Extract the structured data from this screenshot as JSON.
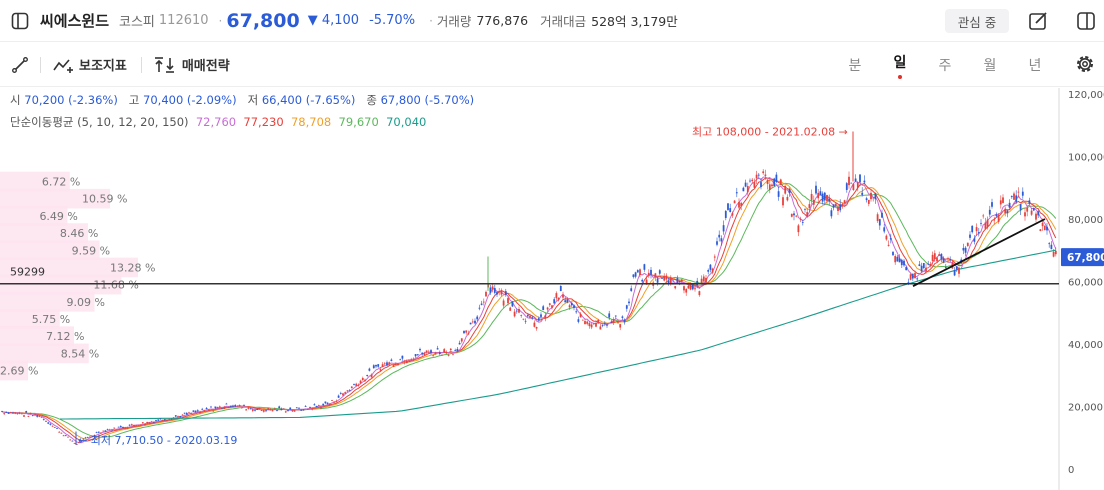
{
  "header": {
    "name": "씨에스윈드",
    "market": "코스피",
    "code": "112610",
    "price": "67,800",
    "change": "▼ 4,100",
    "change_pct": "-5.70%",
    "volume_label": "거래량",
    "volume": "776,876",
    "amount_label": "거래대금",
    "amount": "528억 3,179만",
    "watch_label": "관심 중"
  },
  "toolbar": {
    "indicator_label": "보조지표",
    "strategy_label": "매매전략",
    "periods": [
      "분",
      "일",
      "주",
      "월",
      "년"
    ],
    "active_period": "일"
  },
  "ohlc": {
    "open_label": "시",
    "open": "70,200 (-2.36%)",
    "high_label": "고",
    "high": "70,400 (-2.09%)",
    "low_label": "저",
    "low": "66,400 (-7.65%)",
    "close_label": "종",
    "close": "67,800 (-5.70%)"
  },
  "ma": {
    "label": "단순이동평균 (5, 10, 12, 20, 150)",
    "values": [
      {
        "value": "72,760",
        "color": "#c86dd7"
      },
      {
        "value": "77,230",
        "color": "#e8413b"
      },
      {
        "value": "78,708",
        "color": "#f0a028"
      },
      {
        "value": "79,670",
        "color": "#5cb85c"
      },
      {
        "value": "70,040",
        "color": "#1a9c8c"
      }
    ]
  },
  "colors": {
    "up": "#e8413b",
    "down": "#2b5bd7"
  },
  "chart_data": {
    "type": "candlestick",
    "ylim": [
      0,
      120000
    ],
    "yticks": [
      0,
      20000,
      40000,
      60000,
      80000,
      100000,
      120000
    ],
    "ytick_labels": [
      "0",
      "20,000",
      "40,000",
      "60,000",
      "80,000",
      "100,000",
      "120,000"
    ],
    "current_price": 67800,
    "current_price_label": "67,800",
    "horizontal_line": {
      "value": 59299,
      "label": "59299"
    },
    "high_annotation": {
      "value": 108000,
      "text": "최고 108,000 - 2021.02.08 →"
    },
    "low_annotation": {
      "value": 7710.5,
      "text": "← 최저 7,710.50 - 2020.03.19"
    },
    "volume_profile": [
      {
        "price": 92000,
        "pct": 6.72,
        "label": "6.72 %"
      },
      {
        "price": 86500,
        "pct": 10.59,
        "label": "10.59 %"
      },
      {
        "price": 81000,
        "pct": 6.49,
        "label": "6.49 %"
      },
      {
        "price": 75500,
        "pct": 8.46,
        "label": "8.46 %"
      },
      {
        "price": 70000,
        "pct": 9.59,
        "label": "9.59 %"
      },
      {
        "price": 64500,
        "pct": 13.28,
        "label": "13.28 %"
      },
      {
        "price": 59000,
        "pct": 11.68,
        "label": "11.68 %"
      },
      {
        "price": 53500,
        "pct": 9.09,
        "label": "9.09 %"
      },
      {
        "price": 48000,
        "pct": 5.75,
        "label": "5.75 %"
      },
      {
        "price": 42500,
        "pct": 7.12,
        "label": "7.12 %"
      },
      {
        "price": 37000,
        "pct": 8.54,
        "label": "8.54 %"
      },
      {
        "price": 31500,
        "pct": 2.69,
        "label": "2.69 %"
      }
    ],
    "close_keypoints": [
      {
        "x": 0,
        "y": 18500
      },
      {
        "x": 40,
        "y": 17000
      },
      {
        "x": 58,
        "y": 12500
      },
      {
        "x": 76,
        "y": 8000
      },
      {
        "x": 100,
        "y": 12000
      },
      {
        "x": 140,
        "y": 14500
      },
      {
        "x": 180,
        "y": 17000
      },
      {
        "x": 230,
        "y": 20500
      },
      {
        "x": 260,
        "y": 19000
      },
      {
        "x": 300,
        "y": 19000
      },
      {
        "x": 330,
        "y": 21000
      },
      {
        "x": 355,
        "y": 27000
      },
      {
        "x": 380,
        "y": 33000
      },
      {
        "x": 420,
        "y": 37000
      },
      {
        "x": 455,
        "y": 38000
      },
      {
        "x": 475,
        "y": 47000
      },
      {
        "x": 488,
        "y": 59000
      },
      {
        "x": 505,
        "y": 55000
      },
      {
        "x": 535,
        "y": 46000
      },
      {
        "x": 560,
        "y": 56000
      },
      {
        "x": 580,
        "y": 48000
      },
      {
        "x": 600,
        "y": 47000
      },
      {
        "x": 625,
        "y": 48000
      },
      {
        "x": 635,
        "y": 62000
      },
      {
        "x": 665,
        "y": 61000
      },
      {
        "x": 700,
        "y": 58000
      },
      {
        "x": 712,
        "y": 65000
      },
      {
        "x": 730,
        "y": 84000
      },
      {
        "x": 760,
        "y": 93000
      },
      {
        "x": 785,
        "y": 89000
      },
      {
        "x": 800,
        "y": 78000
      },
      {
        "x": 815,
        "y": 90000
      },
      {
        "x": 835,
        "y": 82000
      },
      {
        "x": 853,
        "y": 93000
      },
      {
        "x": 870,
        "y": 88000
      },
      {
        "x": 890,
        "y": 72000
      },
      {
        "x": 910,
        "y": 60000
      },
      {
        "x": 930,
        "y": 68000
      },
      {
        "x": 955,
        "y": 64000
      },
      {
        "x": 980,
        "y": 78000
      },
      {
        "x": 1000,
        "y": 84000
      },
      {
        "x": 1020,
        "y": 86000
      },
      {
        "x": 1040,
        "y": 79000
      },
      {
        "x": 1056,
        "y": 67800
      }
    ],
    "ma150_keypoints": [
      {
        "x": 60,
        "y": 16000
      },
      {
        "x": 300,
        "y": 16500
      },
      {
        "x": 400,
        "y": 18500
      },
      {
        "x": 500,
        "y": 24000
      },
      {
        "x": 600,
        "y": 31000
      },
      {
        "x": 700,
        "y": 38000
      },
      {
        "x": 800,
        "y": 48000
      },
      {
        "x": 900,
        "y": 58500
      },
      {
        "x": 960,
        "y": 64000
      },
      {
        "x": 1056,
        "y": 70040
      }
    ],
    "trend_line": [
      {
        "x": 913,
        "y": 58500
      },
      {
        "x": 1045,
        "y": 80000
      }
    ]
  }
}
